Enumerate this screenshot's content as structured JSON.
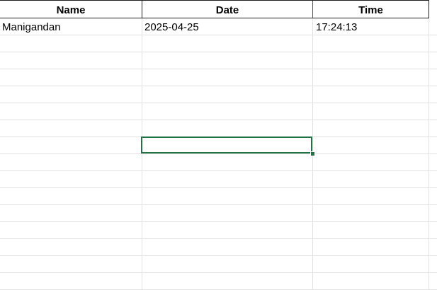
{
  "sheet": {
    "headers": [
      "Name",
      "Date",
      "Time"
    ],
    "rows": [
      [
        "Manigandan",
        "2025-04-25",
        "17:24:13"
      ]
    ],
    "colors": {
      "grid": "#e1e1e1",
      "header_border": "#1f1f1f",
      "selection": "#217346"
    }
  }
}
